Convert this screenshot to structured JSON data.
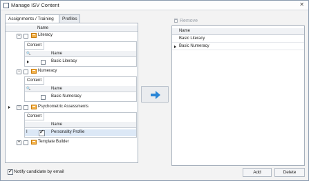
{
  "window": {
    "title": "Manage ISV Content",
    "close_glyph": "✕"
  },
  "tabs": [
    {
      "label": "Assignments / Training"
    },
    {
      "label": "Profiles"
    }
  ],
  "left": {
    "header": "Name",
    "groups": [
      {
        "label": "Literacy",
        "expanded": true,
        "content_tab": "Content",
        "col": "Name",
        "rows": [
          "Basic Literacy"
        ]
      },
      {
        "label": "Numeracy",
        "expanded": true,
        "content_tab": "Content",
        "col": "Name",
        "rows": [
          "Basic Numeracy"
        ]
      },
      {
        "label": "Psychometric Assessments",
        "expanded": true,
        "content_tab": "Content",
        "col": "Name",
        "rows": [
          "Personality Profile"
        ]
      },
      {
        "label": "Template Builder",
        "expanded": false
      }
    ],
    "expand_minus": "−",
    "expand_plus": "+",
    "cursor": "I"
  },
  "right": {
    "remove_label": "Remove",
    "header": "Name",
    "rows": [
      "Basic Literacy",
      "Basic Numeracy"
    ]
  },
  "notify_label": "Notify candidate by email",
  "buttons": {
    "add": "Add",
    "delete": "Delete"
  },
  "colors": {
    "accent": "#2b86d6",
    "folder": "#f3b24a"
  }
}
